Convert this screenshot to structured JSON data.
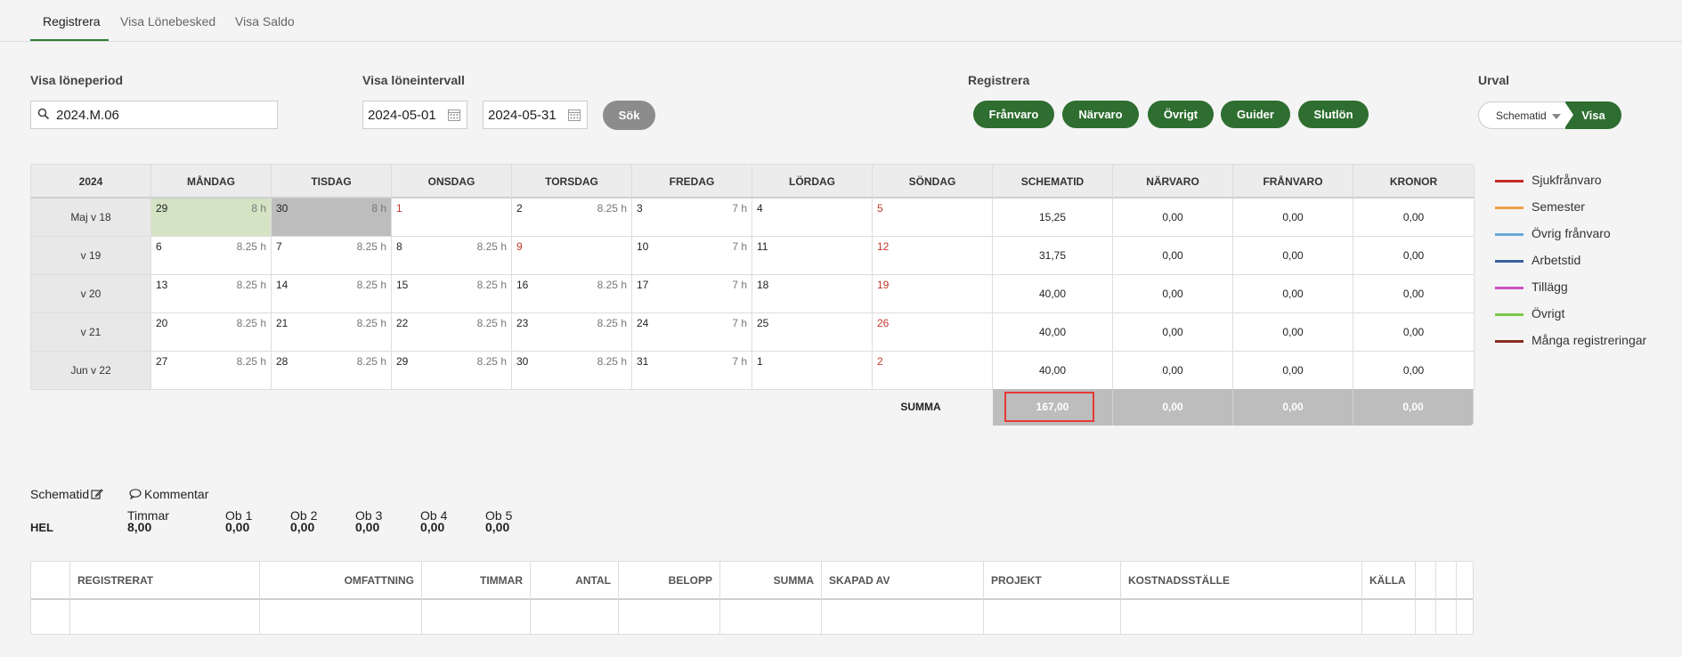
{
  "tabs": [
    {
      "label": "Registrera",
      "active": true
    },
    {
      "label": "Visa Lönebesked",
      "active": false
    },
    {
      "label": "Visa Saldo",
      "active": false
    }
  ],
  "filters": {
    "loneperiod_label": "Visa löneperiod",
    "loneperiod_value": "2024.M.06",
    "loneintervall_label": "Visa löneintervall",
    "date_from": "2024-05-01",
    "date_to": "2024-05-31",
    "sok_label": "Sök"
  },
  "registrera": {
    "label": "Registrera",
    "buttons": [
      "Frånvaro",
      "Närvaro",
      "Övrigt",
      "Guider",
      "Slutlön"
    ]
  },
  "urval": {
    "label": "Urval",
    "selected": "Schematid",
    "visa_label": "Visa"
  },
  "calendar": {
    "headers": [
      "2024",
      "MÅNDAG",
      "TISDAG",
      "ONSDAG",
      "TORSDAG",
      "FREDAG",
      "LÖRDAG",
      "SÖNDAG",
      "SCHEMATID",
      "NÄRVARO",
      "FRÅNVARO",
      "KRONOR"
    ],
    "weeks": [
      {
        "label": "Maj v 18",
        "days": [
          {
            "d": "29",
            "h": "8 h",
            "style": "green"
          },
          {
            "d": "30",
            "h": "8 h",
            "style": "gray"
          },
          {
            "d": "1",
            "h": "",
            "red": true
          },
          {
            "d": "2",
            "h": "8.25 h"
          },
          {
            "d": "3",
            "h": "7 h"
          },
          {
            "d": "4",
            "h": ""
          },
          {
            "d": "5",
            "h": "",
            "red": true
          }
        ],
        "sums": [
          "15,25",
          "0,00",
          "0,00",
          "0,00"
        ]
      },
      {
        "label": "v 19",
        "days": [
          {
            "d": "6",
            "h": "8.25 h"
          },
          {
            "d": "7",
            "h": "8.25 h"
          },
          {
            "d": "8",
            "h": "8.25 h"
          },
          {
            "d": "9",
            "h": "",
            "red": true
          },
          {
            "d": "10",
            "h": "7 h"
          },
          {
            "d": "11",
            "h": ""
          },
          {
            "d": "12",
            "h": "",
            "red": true
          }
        ],
        "sums": [
          "31,75",
          "0,00",
          "0,00",
          "0,00"
        ]
      },
      {
        "label": "v 20",
        "days": [
          {
            "d": "13",
            "h": "8.25 h"
          },
          {
            "d": "14",
            "h": "8.25 h"
          },
          {
            "d": "15",
            "h": "8.25 h"
          },
          {
            "d": "16",
            "h": "8.25 h"
          },
          {
            "d": "17",
            "h": "7 h"
          },
          {
            "d": "18",
            "h": ""
          },
          {
            "d": "19",
            "h": "",
            "red": true
          }
        ],
        "sums": [
          "40,00",
          "0,00",
          "0,00",
          "0,00"
        ]
      },
      {
        "label": "v 21",
        "days": [
          {
            "d": "20",
            "h": "8.25 h"
          },
          {
            "d": "21",
            "h": "8.25 h"
          },
          {
            "d": "22",
            "h": "8.25 h"
          },
          {
            "d": "23",
            "h": "8.25 h"
          },
          {
            "d": "24",
            "h": "7 h"
          },
          {
            "d": "25",
            "h": ""
          },
          {
            "d": "26",
            "h": "",
            "red": true
          }
        ],
        "sums": [
          "40,00",
          "0,00",
          "0,00",
          "0,00"
        ]
      },
      {
        "label": "Jun v 22",
        "days": [
          {
            "d": "27",
            "h": "8.25 h"
          },
          {
            "d": "28",
            "h": "8.25 h"
          },
          {
            "d": "29",
            "h": "8.25 h"
          },
          {
            "d": "30",
            "h": "8.25 h"
          },
          {
            "d": "31",
            "h": "7 h"
          },
          {
            "d": "1",
            "h": ""
          },
          {
            "d": "2",
            "h": "",
            "red": true
          }
        ],
        "sums": [
          "40,00",
          "0,00",
          "0,00",
          "0,00"
        ]
      }
    ],
    "summa_label": "SUMMA",
    "summa": [
      "167,00",
      "0,00",
      "0,00",
      "0,00"
    ]
  },
  "legend": [
    {
      "label": "Sjukfrånvaro",
      "color": "#c62828"
    },
    {
      "label": "Semester",
      "color": "#f0a04b"
    },
    {
      "label": "Övrig frånvaro",
      "color": "#6aa8d8"
    },
    {
      "label": "Arbetstid",
      "color": "#3b5fa0"
    },
    {
      "label": "Tillägg",
      "color": "#c953c4"
    },
    {
      "label": "Övrigt",
      "color": "#7ac943"
    },
    {
      "label": "Många registreringar",
      "color": "#8b2c1f"
    }
  ],
  "schema": {
    "schematid_label": "Schematid",
    "kommentar_label": "Kommentar",
    "row_label": "HEL",
    "columns": [
      {
        "head": "Timmar",
        "value": "8,00"
      },
      {
        "head": "Ob 1",
        "value": "0,00"
      },
      {
        "head": "Ob 2",
        "value": "0,00"
      },
      {
        "head": "Ob 3",
        "value": "0,00"
      },
      {
        "head": "Ob 4",
        "value": "0,00"
      },
      {
        "head": "Ob 5",
        "value": "0,00"
      }
    ]
  },
  "registrations_table": {
    "headers": [
      "",
      "REGISTRERAT",
      "OMFATTNING",
      "TIMMAR",
      "ANTAL",
      "BELOPP",
      "SUMMA",
      "SKAPAD AV",
      "PROJEKT",
      "KOSTNADSSTÄLLE",
      "KÄLLA",
      "",
      "",
      ""
    ]
  },
  "colors": {
    "accent_green": "#2e6e30",
    "today_green": "#d3e3c4",
    "sum_gray": "#bdbdbd",
    "highlight_red": "#e53935"
  }
}
